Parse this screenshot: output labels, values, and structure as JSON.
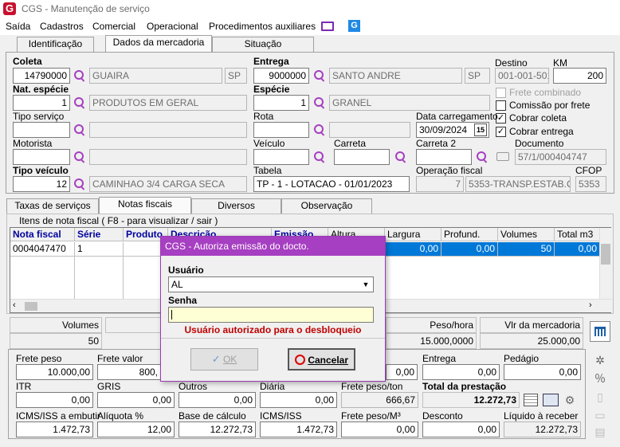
{
  "window": {
    "title": "CGS - Manutenção de serviço",
    "logo": "G"
  },
  "menu": [
    "Saída",
    "Cadastros",
    "Comercial",
    "Operacional",
    "Procedimentos auxiliares"
  ],
  "main_tabs": [
    "Identificação",
    "Dados da mercadoria",
    "Situação"
  ],
  "form": {
    "coleta_label": "Coleta",
    "coleta_code": "14790000",
    "coleta_city": "GUAIRA",
    "coleta_uf": "SP",
    "entrega_label": "Entrega",
    "entrega_code": "9000000",
    "entrega_city": "SANTO ANDRE",
    "entrega_uf": "SP",
    "destino_label": "Destino",
    "destino": "001-001-501",
    "km_label": "KM",
    "km": "200",
    "nat_label": "Nat. espécie",
    "nat_code": "1",
    "nat_desc": "PRODUTOS EM GERAL",
    "especie_label": "Espécie",
    "especie_code": "1",
    "especie_desc": "GRANEL",
    "frete_combinado": "Frete combinado",
    "comissao": "Comissão por frete",
    "cobrar_coleta": "Cobrar coleta",
    "cobrar_entrega": "Cobrar entrega",
    "tipo_servico_label": "Tipo serviço",
    "rota_label": "Rota",
    "data_carreg_label": "Data carregamento",
    "data_carreg": "30/09/2024",
    "cal_num": "15",
    "motorista_label": "Motorista",
    "veiculo_label": "Veículo",
    "carreta_label": "Carreta",
    "carreta2_label": "Carreta 2",
    "documento_label": "Documento",
    "documento": "57/1/000404747",
    "tipo_veiculo_label": "Tipo veículo",
    "tipo_veiculo_code": "12",
    "tipo_veiculo_desc": "CAMINHAO 3/4 CARGA SECA",
    "tabela_label": "Tabela",
    "tabela": "TP - 1 - LOTACAO - 01/01/2023",
    "operacao_label": "Operação fiscal",
    "operacao_code": "7",
    "operacao_desc": "5353-TRANSP.ESTAB.CO",
    "cfop_label": "CFOP",
    "cfop": "5353"
  },
  "sub_tabs": [
    "Taxas de serviços",
    "Notas fiscais",
    "Diversos",
    "Observação"
  ],
  "grid": {
    "caption": "Itens de nota fiscal ( F8 - para visualizar / sair )",
    "headers": [
      "Nota fiscal",
      "Série",
      "Produto",
      "Descrição",
      "Emissão",
      "Altura",
      "Largura",
      "Profund.",
      "Volumes",
      "Total m3"
    ],
    "row": [
      "0004047470",
      "1",
      "",
      "",
      "",
      "",
      "0,00",
      "0,00",
      "50",
      "0,00"
    ]
  },
  "totals": {
    "volumes_label": "Volumes",
    "volumes": "50",
    "peso_hora_label": "Peso/hora",
    "peso_hora": "15.000,0000",
    "vlr_merc_label": "Vlr da mercadoria",
    "vlr_merc": "25.000,00"
  },
  "values": {
    "frete_peso_label": "Frete peso",
    "frete_peso": "10.000,00",
    "frete_valor_label": "Frete valor",
    "frete_valor": "800,",
    "blank_val": "0,00",
    "entrega_label": "Entrega",
    "entrega": "0,00",
    "pedagio_label": "Pedágio",
    "pedagio": "0,00",
    "itr_label": "ITR",
    "itr": "0,00",
    "gris_label": "GRIS",
    "gris": "0,00",
    "outros_label": "Outros",
    "outros": "0,00",
    "diaria_label": "Diária",
    "diaria": "0,00",
    "frete_peso_ton_label": "Frete peso/ton",
    "frete_peso_ton": "666,67",
    "total_prest_label": "Total da prestação",
    "total_prest": "12.272,73",
    "icms_emb_label": "ICMS/ISS a embutir",
    "icms_emb": "1.472,73",
    "aliquota_label": "Alíquota %",
    "aliquota": "12,00",
    "base_label": "Base de cálculo",
    "base": "12.272,73",
    "icms_label": "ICMS/ISS",
    "icms": "1.472,73",
    "frete_m3_label": "Frete peso/M³",
    "frete_m3": "0,00",
    "desconto_label": "Desconto",
    "desconto": "0,00",
    "liquido_label": "Líquido à receber",
    "liquido": "12.272,73"
  },
  "dialog": {
    "title": "CGS - Autoriza emissão do docto.",
    "usuario_label": "Usuário",
    "usuario": "AL",
    "senha_label": "Senha",
    "message": "Usuário autorizado para o desbloqueio",
    "ok": "OK",
    "cancel": "Cancelar"
  },
  "colors": {
    "accent": "#a63fc1",
    "selection": "#0078d7",
    "message": "#c00000"
  }
}
